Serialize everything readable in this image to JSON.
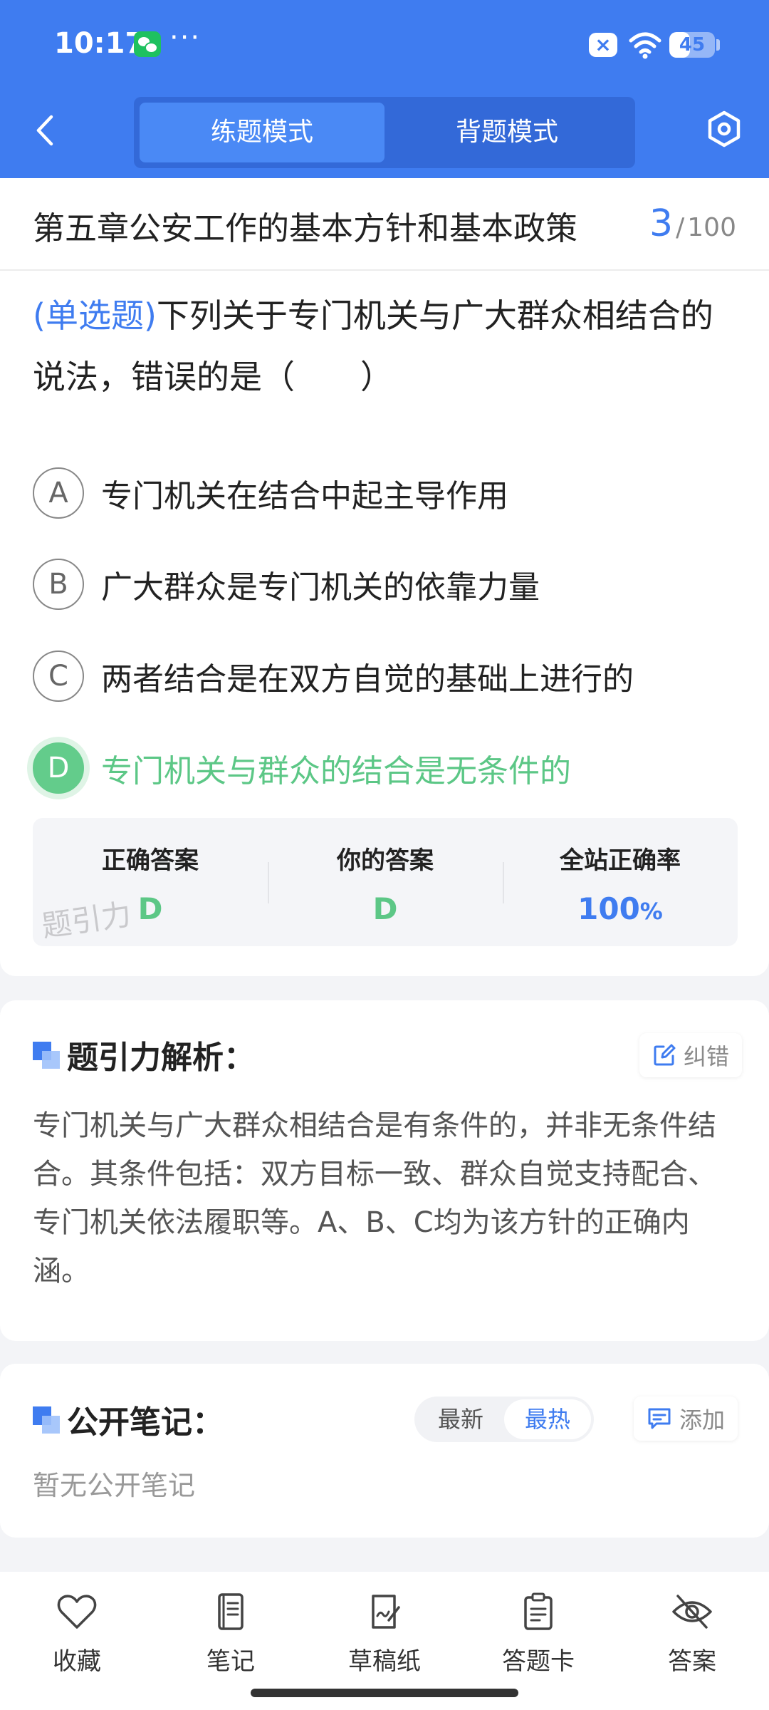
{
  "status_bar": {
    "time": "10:17",
    "more": "···",
    "mute_symbol": "×",
    "battery_percent": 45,
    "battery_label": "45"
  },
  "nav": {
    "tabs": [
      {
        "label": "练题模式",
        "active": true
      },
      {
        "label": "背题模式",
        "active": false
      }
    ]
  },
  "question": {
    "chapter": "第五章公安工作的基本方针和基本政策",
    "current": "3",
    "separator": "/",
    "total": "100",
    "type_label": "(单选题)",
    "text": "下列关于专门机关与广大群众相结合的说法，错误的是（　　）",
    "options": [
      {
        "letter": "A",
        "text": "专门机关在结合中起主导作用",
        "correct": false
      },
      {
        "letter": "B",
        "text": "广大群众是专门机关的依靠力量",
        "correct": false
      },
      {
        "letter": "C",
        "text": "两者结合是在双方自觉的基础上进行的",
        "correct": false
      },
      {
        "letter": "D",
        "text": "专门机关与群众的结合是无条件的",
        "correct": true
      }
    ]
  },
  "answer_summary": {
    "correct_label": "正确答案",
    "correct_value": "D",
    "yours_label": "你的答案",
    "yours_value": "D",
    "rate_label": "全站正确率",
    "rate_value": "100",
    "rate_unit": "%",
    "watermark": "题引力"
  },
  "analysis": {
    "title": "题引力解析：",
    "correct_btn": "纠错",
    "text": "专门机关与广大群众相结合是有条件的，并非无条件结合。其条件包括：双方目标一致、群众自觉支持配合、专门机关依法履职等。A、B、C均为该方针的正确内涵。"
  },
  "notes": {
    "title": "公开笔记：",
    "sort_options": [
      {
        "label": "最新",
        "active": false
      },
      {
        "label": "最热",
        "active": true
      }
    ],
    "add_btn": "添加",
    "empty": "暂无公开笔记"
  },
  "toolbar": {
    "items": [
      {
        "label": "收藏",
        "icon": "heart-icon"
      },
      {
        "label": "笔记",
        "icon": "notebook-icon"
      },
      {
        "label": "草稿纸",
        "icon": "draft-paper-icon"
      },
      {
        "label": "答题卡",
        "icon": "answer-sheet-icon"
      },
      {
        "label": "答案",
        "icon": "eye-off-icon"
      }
    ]
  },
  "colors": {
    "primary": "#3f7cf0",
    "correct_green": "#63cc8b"
  }
}
